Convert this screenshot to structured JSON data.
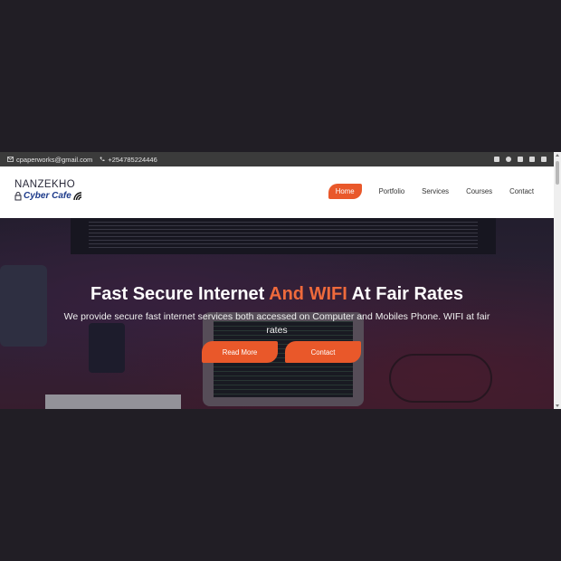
{
  "topbar": {
    "email": "cpaperworks@gmail.com",
    "phone": "+254785224446",
    "social_icons": [
      "facebook-icon",
      "instagram-icon",
      "linkedin-icon",
      "twitter-icon",
      "rss-icon"
    ]
  },
  "logo": {
    "line1": "NANZEKHO",
    "line2": "Cyber Cafe"
  },
  "nav": {
    "items": [
      "Home",
      "Portfolio",
      "Services",
      "Courses",
      "Contact"
    ],
    "active": "Home"
  },
  "hero": {
    "title_part1": "Fast Secure Internet ",
    "title_highlight": "And WIFI",
    "title_part2": " At Fair Rates",
    "subtitle": "We provide secure fast internet services both accessed on Computer and Mobiles Phone. WIFI at fair rates",
    "buttons": [
      "Read More",
      "Contact"
    ]
  },
  "colors": {
    "accent": "#e9582a",
    "topbar": "#3b3b3b",
    "page_background": "#211e25",
    "logo_blue": "#1c3a8a"
  }
}
